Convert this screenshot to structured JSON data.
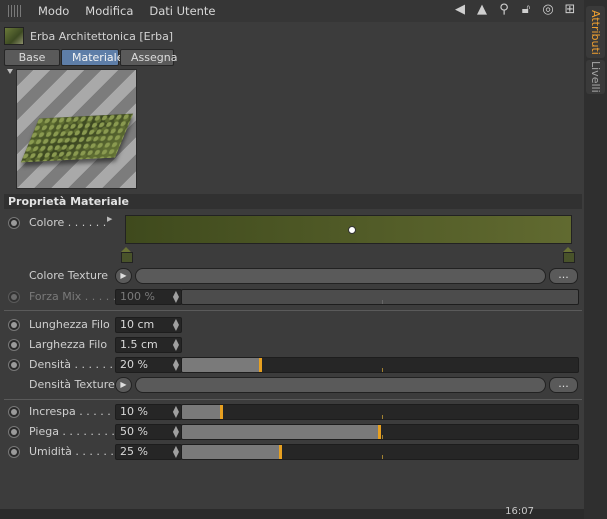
{
  "menubar": {
    "items": [
      "Modo",
      "Modifica",
      "Dati Utente"
    ],
    "icons": [
      "back-arrow-icon",
      "up-arrow-icon",
      "search-icon",
      "lock-icon",
      "target-icon",
      "new-panel-icon"
    ]
  },
  "side_tabs": [
    "Attributi",
    "Livelli"
  ],
  "object": {
    "title": "Erba Architettonica [Erba]"
  },
  "tabs": [
    "Base",
    "Materiale",
    "Assegna"
  ],
  "active_tab": "Materiale",
  "section_title": "Proprietà Materiale",
  "color": {
    "label": "Colore . . . . . .",
    "start_color": "#3f4a1d",
    "end_color": "#616a30"
  },
  "texture_button": "...",
  "rows": {
    "colore_texture": "Colore Texture",
    "forza_mix": {
      "label": "Forza Mix . . . . .",
      "value": "100 %",
      "fill": 1.0
    },
    "lunghezza_filo": {
      "label": "Lunghezza Filo",
      "value": "10 cm"
    },
    "larghezza_filo": {
      "label": "Larghezza Filo",
      "value": "1.5 cm"
    },
    "densita": {
      "label": "Densità . . . . . . .",
      "value": "20 %",
      "fill": 0.2
    },
    "densita_texture": "Densità Texture",
    "increspa": {
      "label": "Increspa . . . . . .",
      "value": "10 %",
      "fill": 0.1
    },
    "piega": {
      "label": "Piega . . . . . . . . .",
      "value": "50 %",
      "fill": 0.5
    },
    "umidita": {
      "label": "Umidità . . . . . . .",
      "value": "25 %",
      "fill": 0.25
    }
  },
  "status": {
    "time": "16:07"
  }
}
